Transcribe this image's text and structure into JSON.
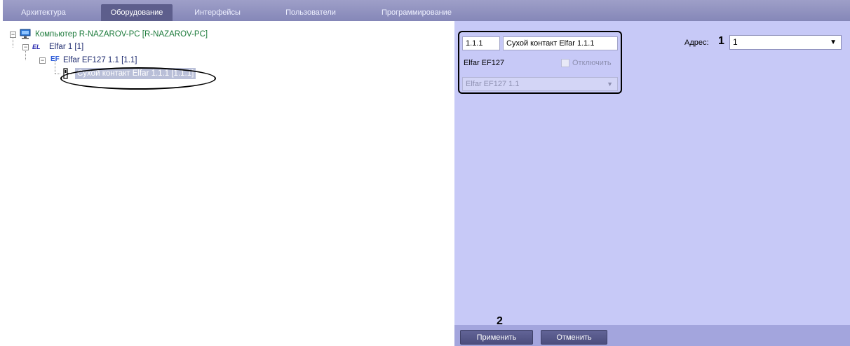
{
  "tabs": [
    {
      "label": "Архитектура"
    },
    {
      "label": "Оборудование"
    },
    {
      "label": "Интерфейсы"
    },
    {
      "label": "Пользователи"
    },
    {
      "label": "Программирование"
    }
  ],
  "tree": {
    "computer": "Компьютер R-NAZAROV-PC [R-NAZAROV-PC]",
    "elfar_badge": "EL",
    "elfar": "Elfar 1 [1]",
    "ef_badge": "EF",
    "module": "Elfar EF127 1.1 [1.1]",
    "contact": "Сухой контакт Elfar 1.1.1 [1.1.1]"
  },
  "panel": {
    "id_value": "1.1.1",
    "name_value": "Сухой контакт Elfar 1.1.1",
    "device_type": "Elfar EF127",
    "disable_label": "Отключить",
    "parent_value": "Elfar EF127 1.1",
    "address_label": "Адрес:",
    "address_value": "1",
    "callout_1": "1",
    "callout_2": "2"
  },
  "buttons": {
    "apply": "Применить",
    "cancel": "Отменить"
  },
  "colors": {
    "tabbar": "#8f91bf",
    "active_tab": "#5d5e8c",
    "panel": "#c7c9f7",
    "bottombar": "#a3a5dd",
    "button": "#55578a"
  }
}
